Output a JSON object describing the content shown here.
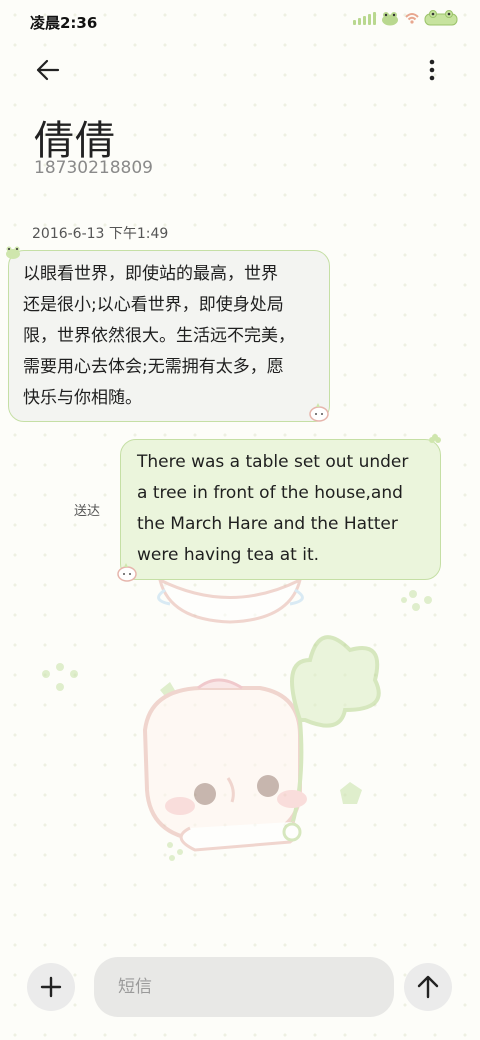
{
  "status_bar": {
    "time": "凌晨2:36"
  },
  "contact": {
    "name": "倩倩",
    "number": "18730218809"
  },
  "conversation": {
    "timestamp": "2016-6-13 下午1:49",
    "incoming": {
      "lines": [
        "以眼看世界，即使站的最高，世界",
        "还是很小;以心看世界，即使身处局",
        "限，世界依然很大。生活远不完美，",
        "需要用心去体会;无需拥有太多，愿",
        "快乐与你相随。"
      ]
    },
    "outgoing": {
      "lines": [
        "There was a table set out under",
        "a tree in front of the house,and",
        "the March Hare and the Hatter",
        "were having tea at it."
      ],
      "status": "送达"
    }
  },
  "composer": {
    "placeholder": "短信"
  },
  "colors": {
    "bubble_border": "#c5dfa5",
    "outgoing_bg": "#ebf5dc",
    "incoming_bg": "#f3f4f1",
    "accent_green": "#b9d88f"
  }
}
